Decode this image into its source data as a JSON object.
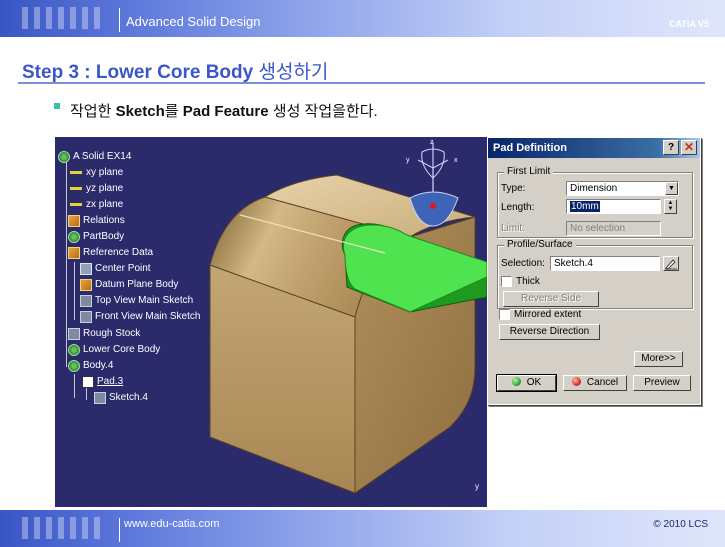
{
  "header": {
    "title": "Advanced Solid Design",
    "product": "CATIA V5"
  },
  "footer": {
    "website": "www.edu-catia.com",
    "copyright": "© 2010 LCS"
  },
  "slide": {
    "step_title_en": "Step 3 : Lower Core Body",
    "step_title_ko": " 생성하기",
    "bullet_pre": "작업한 ",
    "bullet_b1": "Sketch",
    "bullet_mid": "를 ",
    "bullet_b2": "Pad Feature",
    "bullet_post": " 생성 작업을한다."
  },
  "tree": {
    "root": "A Solid EX14",
    "xy": "xy plane",
    "yz": "yz plane",
    "zx": "zx plane",
    "relations": "Relations",
    "partbody": "PartBody",
    "refdata": "Reference Data",
    "centerpoint": "Center Point",
    "datum": "Datum Plane Body",
    "topview": "Top View Main Sketch",
    "frontview": "Front View Main Sketch",
    "rough": "Rough Stock",
    "lowercore": "Lower Core Body",
    "body4": "Body.4",
    "pad3": "Pad.3",
    "sketch4": "Sketch.4"
  },
  "compass": {
    "x": "x",
    "y": "y",
    "z": "z"
  },
  "viewport": {
    "axis_label": "y"
  },
  "dialog": {
    "title": "Pad Definition",
    "help": "?",
    "close": "✕",
    "first_limit": "First Limit",
    "type_label": "Type:",
    "type_value": "Dimension",
    "length_label": "Length:",
    "length_value": "10mm",
    "limit_label": "Limit:",
    "limit_value": "No selection",
    "profile_surface": "Profile/Surface",
    "selection_label": "Selection:",
    "selection_value": "Sketch.4",
    "thick_label": "Thick",
    "reverse_side": "Reverse Side",
    "mirrored_label": "Mirrored extent",
    "reverse_direction": "Reverse Direction",
    "more": "More>>",
    "ok": "OK",
    "cancel": "Cancel",
    "preview": "Preview"
  }
}
